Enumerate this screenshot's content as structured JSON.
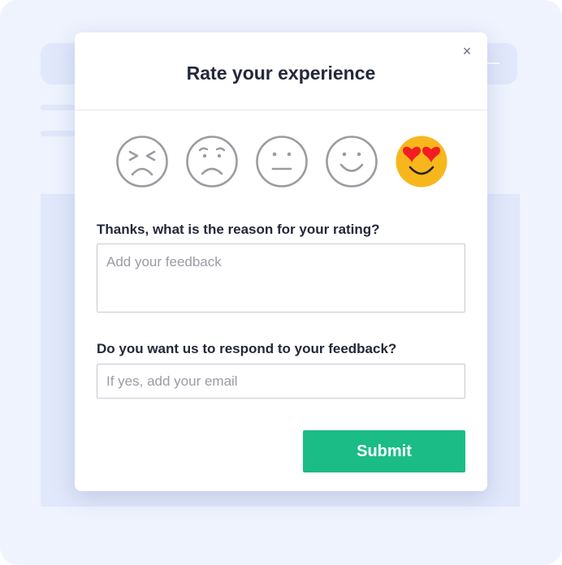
{
  "modal": {
    "title": "Rate your experience",
    "close_glyph": "×",
    "close_icon": "close-icon"
  },
  "rating": {
    "options": [
      {
        "icon": "angry-face-icon",
        "color": "#9a9ca1"
      },
      {
        "icon": "sad-face-icon",
        "color": "#9a9ca1"
      },
      {
        "icon": "neutral-face-icon",
        "color": "#9a9ca1"
      },
      {
        "icon": "happy-face-icon",
        "color": "#9a9ca1"
      },
      {
        "icon": "heart-eyes-face-icon",
        "color": "#f7b71c"
      }
    ],
    "selected_index": 4,
    "heart_color": "#f21d24"
  },
  "reason": {
    "label": "Thanks, what is the reason for your rating?",
    "placeholder": "Add your feedback",
    "value": ""
  },
  "respond": {
    "label": "Do you want us to respond to your feedback?",
    "placeholder": "If yes, add your email",
    "value": ""
  },
  "submit": {
    "label": "Submit",
    "color": "#1bbc85"
  }
}
